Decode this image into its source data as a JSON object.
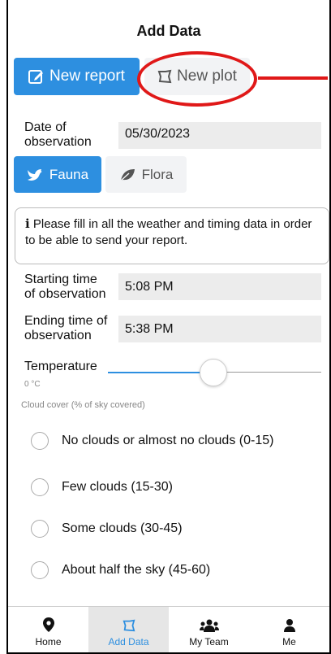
{
  "header": {
    "title": "Add Data"
  },
  "toolbar": {
    "new_report_label": "New report",
    "new_plot_label": "New plot"
  },
  "date": {
    "label_line1": "Date of",
    "label_line2": "observation",
    "value": "05/30/2023"
  },
  "category": {
    "fauna_label": "Fauna",
    "flora_label": "Flora"
  },
  "info": {
    "icon": "i",
    "text": "Please fill in all the weather and timing data in order to be able to send your report."
  },
  "start_time": {
    "label_line1": "Starting time",
    "label_line2": "of observation",
    "value": "5:08 PM"
  },
  "end_time": {
    "label_line1": "Ending time of",
    "label_line2": "observation",
    "value": "5:38 PM"
  },
  "temperature": {
    "label": "Temperature",
    "unit_value": "0 °C",
    "slider_level": 0.5
  },
  "cloud": {
    "label": "Cloud cover (% of sky covered)",
    "options": [
      "No clouds or almost no clouds (0-15)",
      "Few clouds (15-30)",
      "Some clouds (30-45)",
      "About half the sky (45-60)"
    ]
  },
  "nav": {
    "home": "Home",
    "add_data": "Add Data",
    "my_team": "My Team",
    "me": "Me"
  },
  "colors": {
    "accent": "#2d8fe0",
    "annotation": "#e01818"
  }
}
